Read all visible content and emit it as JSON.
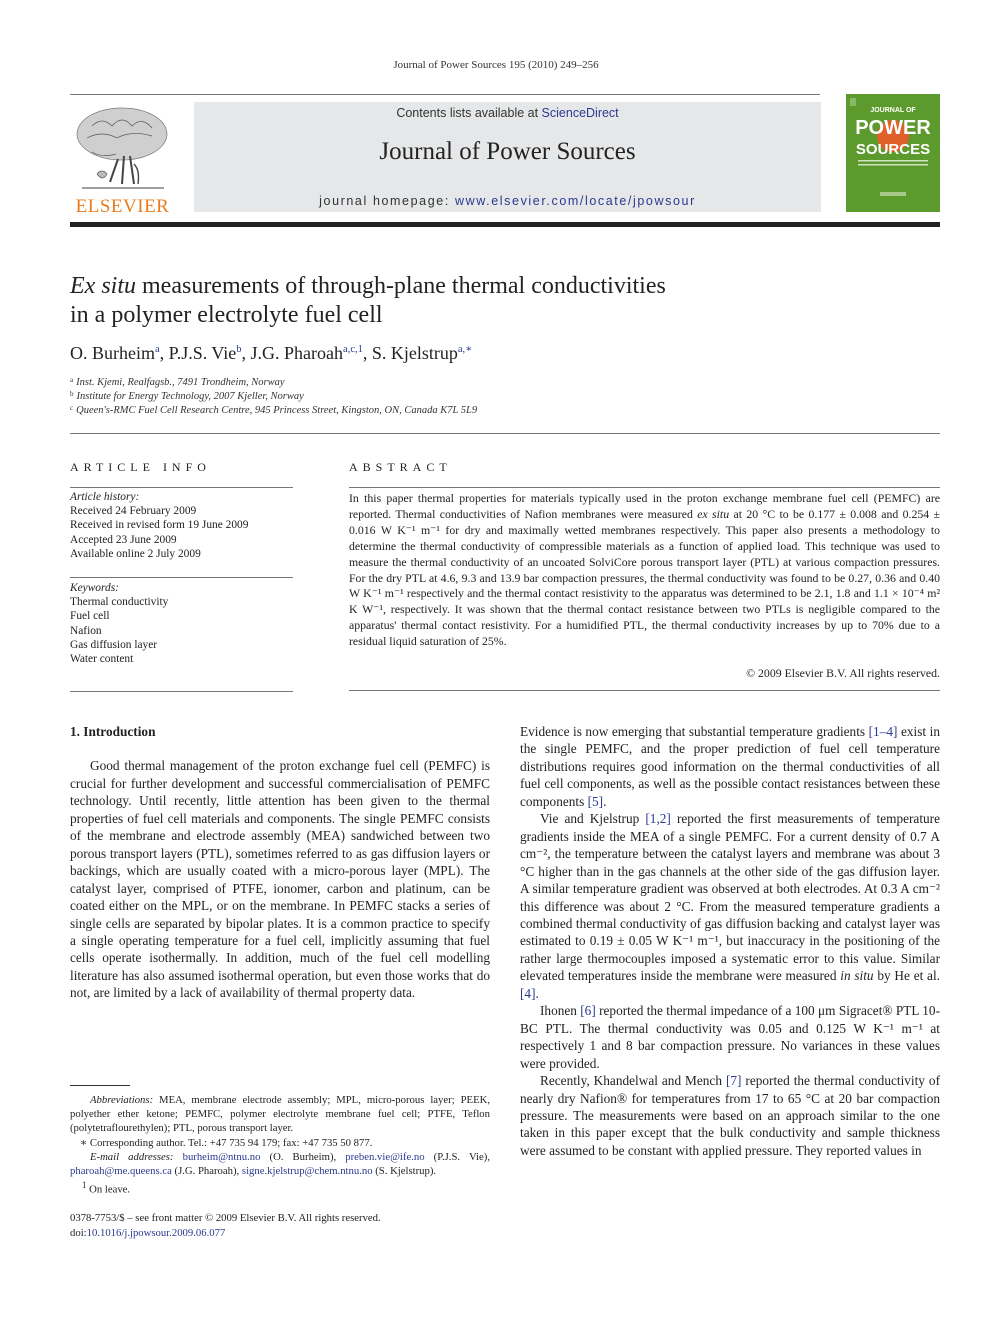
{
  "header": {
    "running_head": "Journal of Power Sources 195 (2010) 249–256",
    "contents_prefix": "Contents lists available at ",
    "contents_link": "ScienceDirect",
    "journal_title": "Journal of Power Sources",
    "homepage_prefix": "journal homepage: ",
    "homepage_link": "www.elsevier.com/locate/jpowsour",
    "publisher_logo": "ELSEVIER",
    "cover": {
      "line1": "JOURNAL OF",
      "line2": "POWER",
      "line3": "SOURCES",
      "background": "#5c9a2e",
      "accent": "#e0602a"
    },
    "colors": {
      "link": "#2b3990",
      "publisher_orange": "#e87d1e",
      "banner_bg": "#e6e7e8"
    }
  },
  "title": {
    "italic_part": "Ex situ",
    "rest_line1": " measurements of through-plane thermal conductivities",
    "line2": "in a polymer electrolyte fuel cell"
  },
  "authors": [
    {
      "name": "O. Burheim",
      "sup": "a",
      "sep": ", "
    },
    {
      "name": "P.J.S. Vie",
      "sup": "b",
      "sep": ", "
    },
    {
      "name": "J.G. Pharoah",
      "sup": "a,c,1",
      "sep": ", "
    },
    {
      "name": "S. Kjelstrup",
      "sup": "a,∗",
      "sep": ""
    }
  ],
  "affiliations": [
    {
      "mark": "a",
      "text": "Inst. Kjemi, Realfagsb., 7491 Trondheim, Norway"
    },
    {
      "mark": "b",
      "text": "Institute for Energy Technology, 2007 Kjeller, Norway"
    },
    {
      "mark": "c",
      "text": "Queen's-RMC Fuel Cell Research Centre, 945 Princess Street, Kingston, ON, Canada K7L 5L9"
    }
  ],
  "article_info": {
    "heading": "ARTICLE INFO",
    "history_label": "Article history:",
    "history": [
      "Received 24 February 2009",
      "Received in revised form 19 June 2009",
      "Accepted 23 June 2009",
      "Available online 2 July 2009"
    ],
    "keywords_label": "Keywords:",
    "keywords": [
      "Thermal conductivity",
      "Fuel cell",
      "Nafion",
      "Gas diffusion layer",
      "Water content"
    ]
  },
  "abstract": {
    "heading": "ABSTRACT",
    "s1": "In this paper thermal properties for materials typically used in the proton exchange membrane fuel cell (PEMFC) are reported. Thermal conductivities of Nafion membranes were measured ",
    "s1_italic": "ex situ",
    "s2": " at 20 °C to be 0.177 ± 0.008 and 0.254 ± 0.016 W K⁻¹ m⁻¹ for dry and maximally wetted membranes respectively. This paper also presents a methodology to determine the thermal conductivity of compressible materials as a function of applied load. This technique was used to measure the thermal conductivity of an uncoated SolviCore porous transport layer (PTL) at various compaction pressures. For the dry PTL at 4.6, 9.3 and 13.9 bar compaction pressures, the thermal conductivity was found to be 0.27, 0.36 and 0.40 W K⁻¹ m⁻¹ respectively and the thermal contact resistivity to the apparatus was determined to be 2.1, 1.8 and 1.1 × 10⁻⁴ m² K W⁻¹, respectively. It was shown that the thermal contact resistance between two PTLs is negligible compared to the apparatus' thermal contact resistivity. For a humidified PTL, the thermal conductivity increases by up to 70% due to a residual liquid saturation of 25%.",
    "copyright": "© 2009 Elsevier B.V. All rights reserved."
  },
  "body": {
    "section_heading": "1.  Introduction",
    "left_para1": "Good thermal management of the proton exchange fuel cell (PEMFC) is crucial for further development and successful commercialisation of PEMFC technology. Until recently, little attention has been given to the thermal properties of fuel cell materials and components. The single PEMFC consists of the membrane and electrode assembly (MEA) sandwiched between two porous transport layers (PTL), sometimes referred to as gas diffusion layers or backings, which are usually coated with a micro-porous layer (MPL). The catalyst layer, comprised of PTFE, ionomer, carbon and platinum, can be coated either on the MPL, or on the membrane. In PEMFC stacks a series of single cells are separated by bipolar plates. It is a common practice to specify a single operating temperature for a fuel cell, implicitly assuming that fuel cells operate isothermally. In addition, much of the fuel cell modelling literature has also assumed isothermal operation, but even those works that do not, are limited by a lack of availability of thermal property data.",
    "right_p1_a": "Evidence is now emerging that substantial temperature gradients ",
    "right_p1_ref1": "[1–4]",
    "right_p1_b": " exist in the single PEMFC, and the proper prediction of fuel cell temperature distributions requires good information on the thermal conductivities of all fuel cell components, as well as the possible contact resistances between these components ",
    "right_p1_ref2": "[5]",
    "right_p1_c": ".",
    "right_p2_a": "Vie and Kjelstrup ",
    "right_p2_ref1": "[1,2]",
    "right_p2_b": " reported the first measurements of temperature gradients inside the MEA of a single PEMFC. For a current density of 0.7 A cm⁻², the temperature between the catalyst layers and membrane was about 3 °C higher than in the gas channels at the other side of the gas diffusion layer. A similar temperature gradient was observed at both electrodes. At 0.3 A cm⁻² this difference was about 2 °C. From the measured temperature gradients a combined thermal conductivity of gas diffusion backing and catalyst layer was estimated to 0.19 ± 0.05 W K⁻¹ m⁻¹, but inaccuracy in the positioning of the rather large thermocouples imposed a systematic error to this value. Similar elevated temperatures inside the membrane were measured ",
    "right_p2_italic": "in situ",
    "right_p2_c": " by He et al. ",
    "right_p2_ref2": "[4]",
    "right_p2_d": ".",
    "right_p3_a": "Ihonen ",
    "right_p3_ref": "[6]",
    "right_p3_b": " reported the thermal impedance of a 100 μm Sigracet® PTL 10-BC PTL. The thermal conductivity was 0.05 and 0.125 W K⁻¹ m⁻¹ at respectively 1 and 8 bar compaction pressure. No variances in these values were provided.",
    "right_p4_a": "Recently, Khandelwal and Mench ",
    "right_p4_ref": "[7]",
    "right_p4_b": " reported the thermal conductivity of nearly dry Nafion® for temperatures from 17 to 65 °C at 20 bar compaction pressure. The measurements were based on an approach similar to the one taken in this paper except that the bulk conductivity and sample thickness were assumed to be constant with applied pressure. They reported values in"
  },
  "footnotes": {
    "abbrev_label": "Abbreviations:",
    "abbrev_text": " MEA, membrane electrode assembly; MPL, micro-porous layer; PEEK, polyether ether ketone; PEMFC, polymer electrolyte membrane fuel cell; PTFE, Teflon (polytetraflourethylen); PTL, porous transport layer.",
    "corresponding": "∗  Corresponding author. Tel.: +47 735 94 179; fax: +47 735 50 877.",
    "email_label": "E-mail addresses:",
    "emails": [
      {
        "addr": "burheim@ntnu.no",
        "who": " (O. Burheim), "
      },
      {
        "addr": "preben.vie@ife.no",
        "who": " (P.J.S. Vie), "
      },
      {
        "addr": "pharoah@me.queens.ca",
        "who": " (J.G. Pharoah), "
      },
      {
        "addr": "signe.kjelstrup@chem.ntnu.no",
        "who": " (S. Kjelstrup)."
      }
    ],
    "note1_mark": "1",
    "note1_text": " On leave.",
    "front_matter": "0378-7753/$ – see front matter © 2009 Elsevier B.V. All rights reserved.",
    "doi_prefix": "doi:",
    "doi": "10.1016/j.jpowsour.2009.06.077"
  }
}
